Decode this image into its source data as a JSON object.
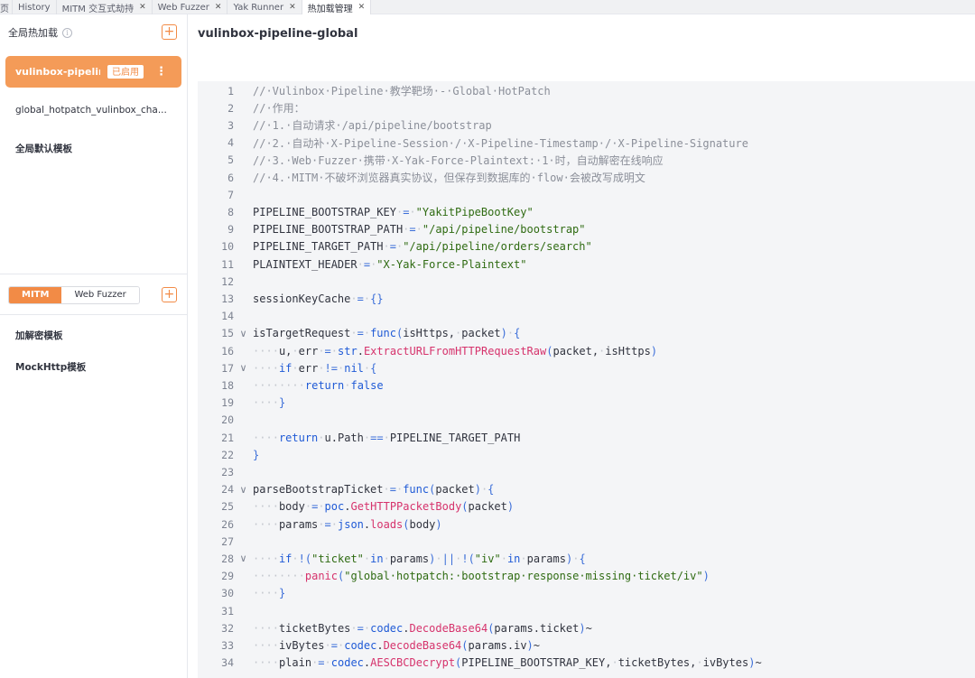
{
  "tabs": [
    {
      "label": "页",
      "closable": false
    },
    {
      "label": "History",
      "closable": false
    },
    {
      "label": "MITM 交互式劫持",
      "closable": true
    },
    {
      "label": "Web Fuzzer",
      "closable": true
    },
    {
      "label": "Yak Runner",
      "closable": true
    },
    {
      "label": "热加载管理",
      "closable": true,
      "active": true
    }
  ],
  "sidebar": {
    "header_label": "全局热加载",
    "info_glyph": "i",
    "add_glyph": "+",
    "active_item": {
      "name": "vulinbox-pipeline...",
      "badge": "已启用",
      "menu_glyph": "⋮"
    },
    "items": [
      {
        "name": "global_hotpatch_vulinbox_cha..."
      },
      {
        "name": "全局默认模板"
      }
    ],
    "segment": {
      "options": [
        "MITM",
        "Web Fuzzer"
      ],
      "selected": "MITM"
    },
    "templates": [
      {
        "name": "加解密模板"
      },
      {
        "name": "MockHttp模板"
      }
    ]
  },
  "main": {
    "title": "vulinbox-pipeline-global"
  },
  "editor": {
    "lines": [
      {
        "n": "1",
        "fold": false,
        "text": "//·Vulinbox·Pipeline·教学靶场·-·Global·HotPatch"
      },
      {
        "n": "2",
        "fold": false,
        "text": "//·作用："
      },
      {
        "n": "3",
        "fold": false,
        "text": "//·1.·自动请求·/api/pipeline/bootstrap"
      },
      {
        "n": "4",
        "fold": false,
        "text": "//·2.·自动补·X-Pipeline-Session·/·X-Pipeline-Timestamp·/·X-Pipeline-Signature"
      },
      {
        "n": "5",
        "fold": false,
        "text": "//·3.·Web·Fuzzer·携带·X-Yak-Force-Plaintext:·1·时，自动解密在线响应"
      },
      {
        "n": "6",
        "fold": false,
        "text": "//·4.·MITM·不破坏浏览器真实协议，但保存到数据库的·flow·会被改写成明文"
      },
      {
        "n": "7",
        "fold": false,
        "text": ""
      },
      {
        "n": "8",
        "fold": false,
        "text": "PIPELINE_BOOTSTRAP_KEY·=·\"YakitPipeBootKey\""
      },
      {
        "n": "9",
        "fold": false,
        "text": "PIPELINE_BOOTSTRAP_PATH·=·\"/api/pipeline/bootstrap\""
      },
      {
        "n": "10",
        "fold": false,
        "text": "PIPELINE_TARGET_PATH·=·\"/api/pipeline/orders/search\""
      },
      {
        "n": "11",
        "fold": false,
        "text": "PLAINTEXT_HEADER·=·\"X-Yak-Force-Plaintext\""
      },
      {
        "n": "12",
        "fold": false,
        "text": ""
      },
      {
        "n": "13",
        "fold": false,
        "text": "sessionKeyCache·=·{}"
      },
      {
        "n": "14",
        "fold": false,
        "text": ""
      },
      {
        "n": "15",
        "fold": true,
        "text": "isTargetRequest·=·func(isHttps,·packet)·{"
      },
      {
        "n": "16",
        "fold": false,
        "text": "····u,·err·=·str.ExtractURLFromHTTPRequestRaw(packet,·isHttps)"
      },
      {
        "n": "17",
        "fold": true,
        "text": "····if·err·!=·nil·{"
      },
      {
        "n": "18",
        "fold": false,
        "text": "········return·false"
      },
      {
        "n": "19",
        "fold": false,
        "text": "····}"
      },
      {
        "n": "20",
        "fold": false,
        "text": ""
      },
      {
        "n": "21",
        "fold": false,
        "text": "····return·u.Path·==·PIPELINE_TARGET_PATH"
      },
      {
        "n": "22",
        "fold": false,
        "text": "}"
      },
      {
        "n": "23",
        "fold": false,
        "text": ""
      },
      {
        "n": "24",
        "fold": true,
        "text": "parseBootstrapTicket·=·func(packet)·{"
      },
      {
        "n": "25",
        "fold": false,
        "text": "····body·=·poc.GetHTTPPacketBody(packet)"
      },
      {
        "n": "26",
        "fold": false,
        "text": "····params·=·json.loads(body)"
      },
      {
        "n": "27",
        "fold": false,
        "text": ""
      },
      {
        "n": "28",
        "fold": true,
        "text": "····if·!(\"ticket\"·in·params)·||·!(\"iv\"·in·params)·{"
      },
      {
        "n": "29",
        "fold": false,
        "text": "········panic(\"global·hotpatch:·bootstrap·response·missing·ticket/iv\")"
      },
      {
        "n": "30",
        "fold": false,
        "text": "····}"
      },
      {
        "n": "31",
        "fold": false,
        "text": ""
      },
      {
        "n": "32",
        "fold": false,
        "text": "····ticketBytes·=·codec.DecodeBase64(params.ticket)~"
      },
      {
        "n": "33",
        "fold": false,
        "text": "····ivBytes·=·codec.DecodeBase64(params.iv)~"
      },
      {
        "n": "34",
        "fold": false,
        "text": "····plain·=·codec.AESCBCDecrypt(PIPELINE_BOOTSTRAP_KEY,·ticketBytes,·ivBytes)~"
      }
    ]
  },
  "colors": {
    "accent": "#f28b46",
    "active_item_bg": "#f49b58",
    "editor_bg": "#f4f5f7",
    "comment": "#8b8f99",
    "keyword": "#1f5ad6",
    "function": "#d6336c",
    "string": "#2f6b12"
  }
}
